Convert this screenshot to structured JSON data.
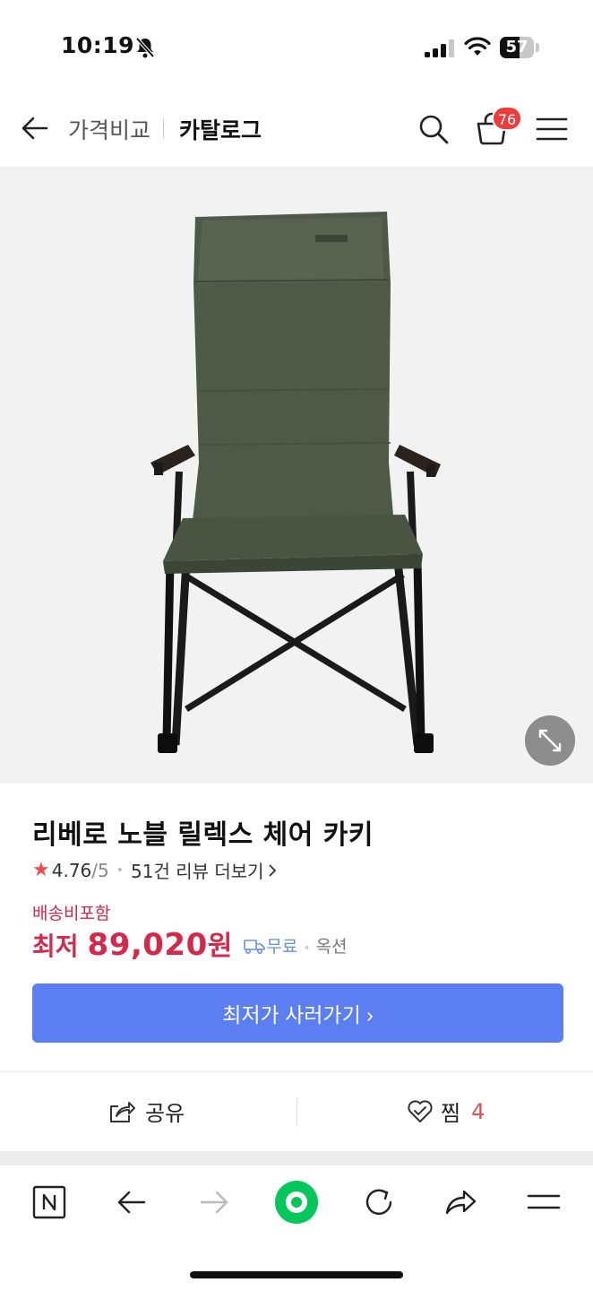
{
  "status_bar": {
    "time": "10:19",
    "battery": "57",
    "battery_fraction": 0.57
  },
  "header": {
    "breadcrumb_parent": "가격비교",
    "breadcrumb_current": "카탈로그",
    "cart_count": "76"
  },
  "product": {
    "title": "리베로 노블 릴렉스 체어 카키",
    "rating": "4.76",
    "rating_max": "/5",
    "reviews_link": "51건 리뷰 더보기",
    "shipping_label": "배송비포함",
    "price_prefix": "최저",
    "price": "89,020",
    "price_unit": "원",
    "free_shipping": "무료",
    "seller": "옥션",
    "buy_button": "최저가 사러가기 ›"
  },
  "actions": {
    "share_label": "공유",
    "like_label": "찜",
    "like_count": "4"
  },
  "icons": {
    "back": "arrow-left-icon",
    "search": "search-icon",
    "cart": "shopping-bag-icon",
    "menu": "hamburger-icon",
    "expand": "expand-icon",
    "share": "share-icon",
    "like": "heart-icon"
  },
  "colors": {
    "accent_red": "#d4294a",
    "button_blue": "#5b7ff3",
    "badge_red": "#ef3b3b",
    "naver_green": "#03c75a",
    "free_blue": "#6b90d6"
  }
}
